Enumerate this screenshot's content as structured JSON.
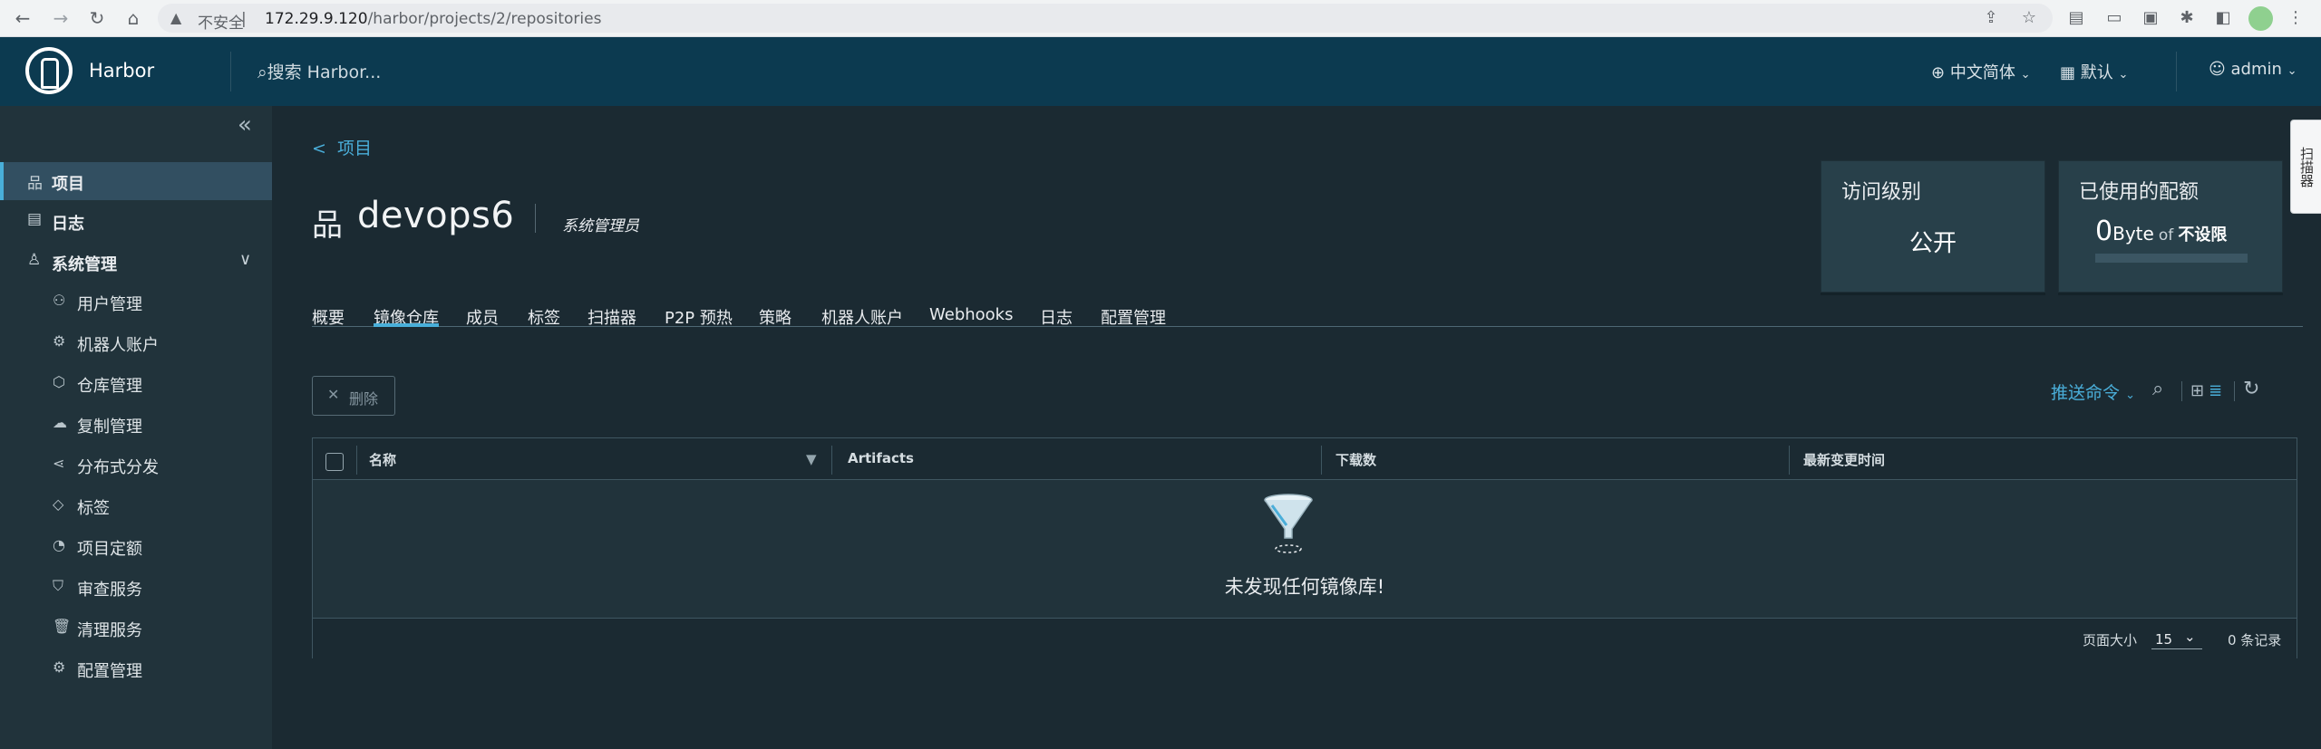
{
  "browser": {
    "insecure_label": "不安全",
    "url_host": "172.29.9.120",
    "url_path": "/harbor/projects/2/repositories"
  },
  "header": {
    "brand": "Harbor",
    "search_placeholder": "搜索 Harbor...",
    "language": "中文简体",
    "datetime_format": "默认",
    "user": "admin"
  },
  "sidebar": {
    "items": [
      {
        "label": "项目",
        "icon": "projects-icon"
      },
      {
        "label": "日志",
        "icon": "logs-icon"
      },
      {
        "label": "系统管理",
        "icon": "admin-icon"
      }
    ],
    "sub_items": [
      {
        "label": "用户管理",
        "icon": "users-icon"
      },
      {
        "label": "机器人账户",
        "icon": "robot-icon"
      },
      {
        "label": "仓库管理",
        "icon": "registry-icon"
      },
      {
        "label": "复制管理",
        "icon": "replication-icon"
      },
      {
        "label": "分布式分发",
        "icon": "distribution-icon"
      },
      {
        "label": "标签",
        "icon": "tag-icon"
      },
      {
        "label": "项目定额",
        "icon": "quota-icon"
      },
      {
        "label": "审查服务",
        "icon": "shield-icon"
      },
      {
        "label": "清理服务",
        "icon": "trash-icon"
      },
      {
        "label": "配置管理",
        "icon": "gear-icon"
      }
    ]
  },
  "project": {
    "breadcrumb": "项目",
    "name": "devops6",
    "role": "系统管理员",
    "access_card": {
      "title": "访问级别",
      "value": "公开"
    },
    "quota_card": {
      "title": "已使用的配额",
      "used_num": "0",
      "used_unit": "Byte",
      "of": "of",
      "limit": "不设限",
      "used_fraction": 0
    }
  },
  "tabs": [
    "概要",
    "镜像仓库",
    "成员",
    "标签",
    "扫描器",
    "P2P 预热",
    "策略",
    "机器人账户",
    "Webhooks",
    "日志",
    "配置管理"
  ],
  "active_tab": "镜像仓库",
  "toolbar": {
    "delete_label": "删除",
    "push_command": "推送命令"
  },
  "grid": {
    "columns": [
      "名称",
      "Artifacts",
      "下载数",
      "最新变更时间"
    ],
    "empty_text": "未发现任何镜像库!",
    "page_size_label": "页面大小",
    "page_size": "15",
    "total": "0 条记录"
  },
  "side_tab": "扫描器"
}
